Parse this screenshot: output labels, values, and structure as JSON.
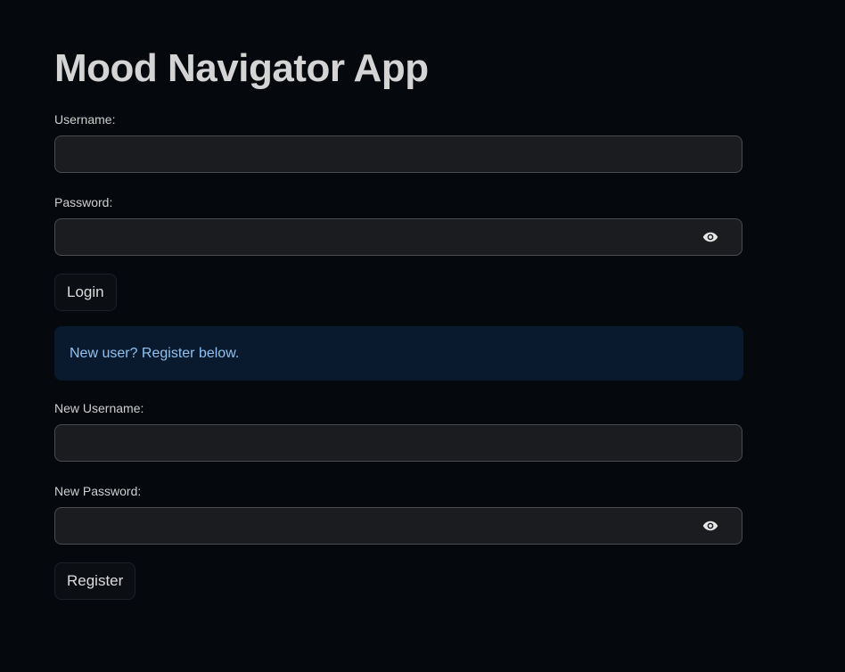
{
  "app": {
    "title": "Mood Navigator App"
  },
  "login": {
    "username_label": "Username:",
    "username_value": "",
    "password_label": "Password:",
    "password_value": "",
    "submit_label": "Login"
  },
  "info": {
    "message": "New user? Register below."
  },
  "register": {
    "username_label": "New Username:",
    "username_value": "",
    "password_label": "New Password:",
    "password_value": "",
    "submit_label": "Register"
  },
  "icons": {
    "password_toggle": "eye-icon"
  },
  "colors": {
    "background": "#05080d",
    "input_background": "#1a1c1f",
    "info_background": "#0a1a2e",
    "info_text": "#8ec2f2"
  }
}
